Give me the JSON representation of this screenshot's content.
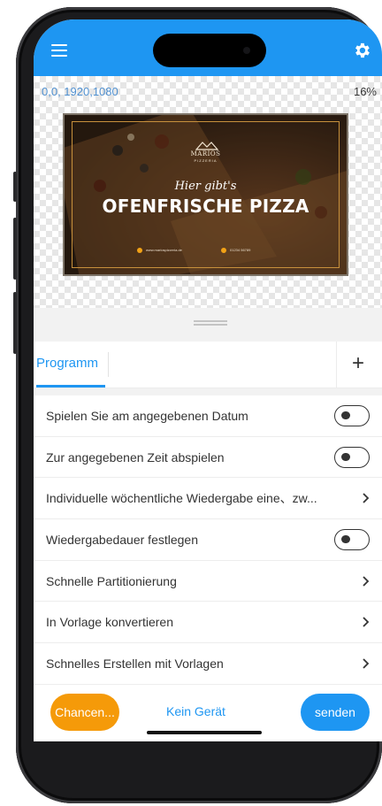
{
  "preview": {
    "coordinates": "0,0, 1920,1080",
    "zoom": "16%",
    "poster": {
      "brand_name": "MARIOS",
      "brand_sub": "PIZZERIA",
      "script_line": "Hier gibt's",
      "headline": "OFENFRISCHE PIZZA",
      "contact_web": "www.mariospizzeria.de",
      "contact_phone": "01234 56789"
    }
  },
  "tabs": {
    "active": "Programm",
    "add_symbol": "+"
  },
  "settings": [
    {
      "label": "Spielen Sie am angegebenen Datum",
      "control": "toggle",
      "on": false
    },
    {
      "label": "Zur angegebenen Zeit abspielen",
      "control": "toggle",
      "on": false
    },
    {
      "label": "Individuelle wöchentliche Wiedergabe eine、zw...",
      "control": "chevron"
    },
    {
      "label": "Wiedergabedauer festlegen",
      "control": "toggle",
      "on": false
    },
    {
      "label": "Schnelle Partitionierung",
      "control": "chevron"
    },
    {
      "label": "In Vorlage konvertieren",
      "control": "chevron"
    },
    {
      "label": "Schnelles Erstellen mit Vorlagen",
      "control": "chevron"
    }
  ],
  "bottom_bar": {
    "left_button": "Chancen...",
    "status": "Kein Gerät",
    "right_button": "senden"
  },
  "colors": {
    "accent": "#1e96f2",
    "orange": "#f59a09",
    "gold": "#c7903c"
  },
  "icons": {
    "menu": "hamburger-icon",
    "settings": "gear-icon",
    "add": "plus-icon",
    "chevron": "chevron-right-icon"
  }
}
